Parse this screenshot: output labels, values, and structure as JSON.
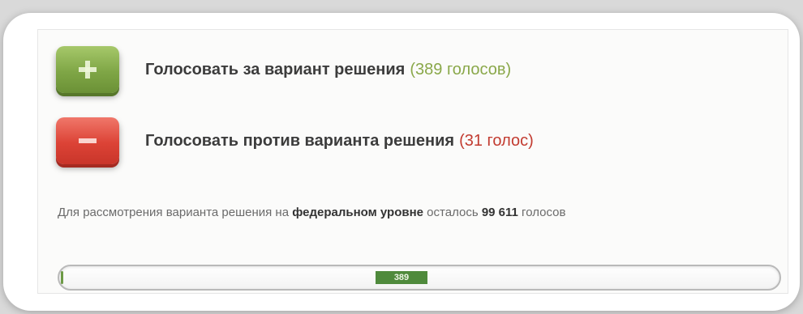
{
  "vote_for": {
    "button_icon": "plus-icon",
    "label": "Голосовать за вариант решения",
    "count_text": "(389 голосов)",
    "color": "#7fa646",
    "count_color": "#8aa84a"
  },
  "vote_against": {
    "button_icon": "minus-icon",
    "label": "Голосовать против варианта решения",
    "count_text": "(31 голос)",
    "color": "#dc4336",
    "count_color": "#c23b30"
  },
  "info": {
    "prefix": "Для рассмотрения варианта решения на ",
    "level": "федеральном уровне",
    "middle": " осталось ",
    "remaining": "99 611",
    "suffix": " голосов"
  },
  "progress": {
    "label": "389",
    "value": 389,
    "target": 100000,
    "fill_color": "#6d9a45"
  }
}
